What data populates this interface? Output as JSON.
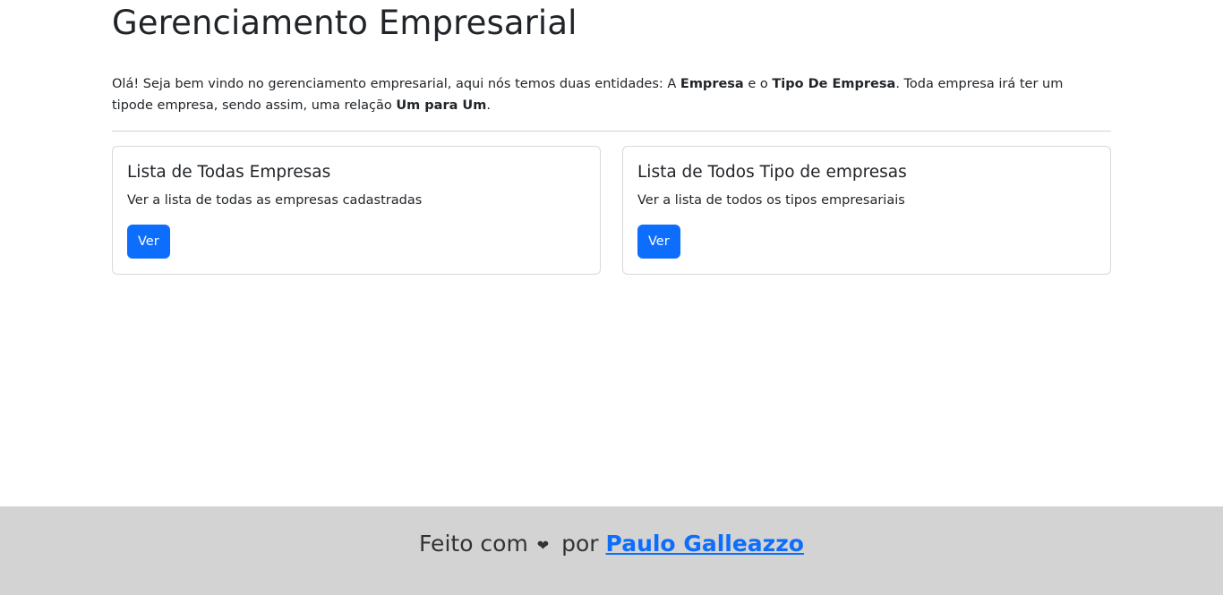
{
  "header": {
    "title": "Gerenciamento Empresarial"
  },
  "intro": {
    "part1": "Olá! Seja bem vindo no gerenciamento empresarial, aqui nós temos duas entidades: A ",
    "bold1": "Empresa",
    "part2": " e o ",
    "bold2": "Tipo De Empresa",
    "part3": ". Toda empresa irá ter um tipode empresa, sendo assim, uma relação ",
    "bold3": "Um para Um",
    "part4": "."
  },
  "cards": [
    {
      "title": "Lista de Todas Empresas",
      "text": "Ver a lista de todas as empresas cadastradas",
      "button_label": "Ver"
    },
    {
      "title": "Lista de Todos Tipo de empresas",
      "text": "Ver a lista de todos os tipos empresariais",
      "button_label": "Ver"
    }
  ],
  "footer": {
    "prefix": "Feito com",
    "heart_icon": "heart-icon",
    "middle": "por",
    "author": "Paulo Galleazzo"
  },
  "colors": {
    "primary": "#0d6efd",
    "footer_bg": "#d3d3d3",
    "text": "#212529"
  }
}
